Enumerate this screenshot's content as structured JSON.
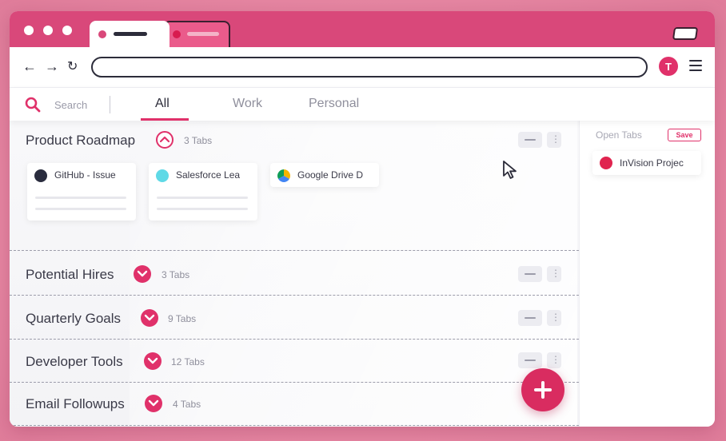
{
  "browser": {
    "colors": {
      "tabstrip": "#d9487a",
      "accent": "#e0316a"
    },
    "extension_icon": "T"
  },
  "app": {
    "search_label": "Search",
    "filters": [
      {
        "label": "All",
        "active": true
      },
      {
        "label": "Work",
        "active": false
      },
      {
        "label": "Personal",
        "active": false
      }
    ],
    "groups": [
      {
        "title": "Product Roadmap",
        "count": "3 Tabs",
        "expanded": true,
        "tabs": [
          {
            "title": "GitHub - Issue",
            "icon": "github-icon",
            "color": "#2a2c3e"
          },
          {
            "title": "Salesforce Lea",
            "icon": "salesforce-icon",
            "color": "#5fd9e6"
          },
          {
            "title": "Google Drive D",
            "icon": "google-drive-icon",
            "color": "#f4b400"
          }
        ]
      },
      {
        "title": "Potential Hires",
        "count": "3 Tabs",
        "expanded": false
      },
      {
        "title": "Quarterly Goals",
        "count": "9 Tabs",
        "expanded": false
      },
      {
        "title": "Developer Tools",
        "count": "12 Tabs",
        "expanded": false
      },
      {
        "title": "Email Followups",
        "count": "4 Tabs",
        "expanded": false
      }
    ],
    "side_panel": {
      "title": "Open Tabs",
      "save_label": "Save",
      "tabs": [
        {
          "title": "InVision Projec",
          "icon": "invision-icon",
          "color": "#e0244f"
        }
      ]
    }
  }
}
